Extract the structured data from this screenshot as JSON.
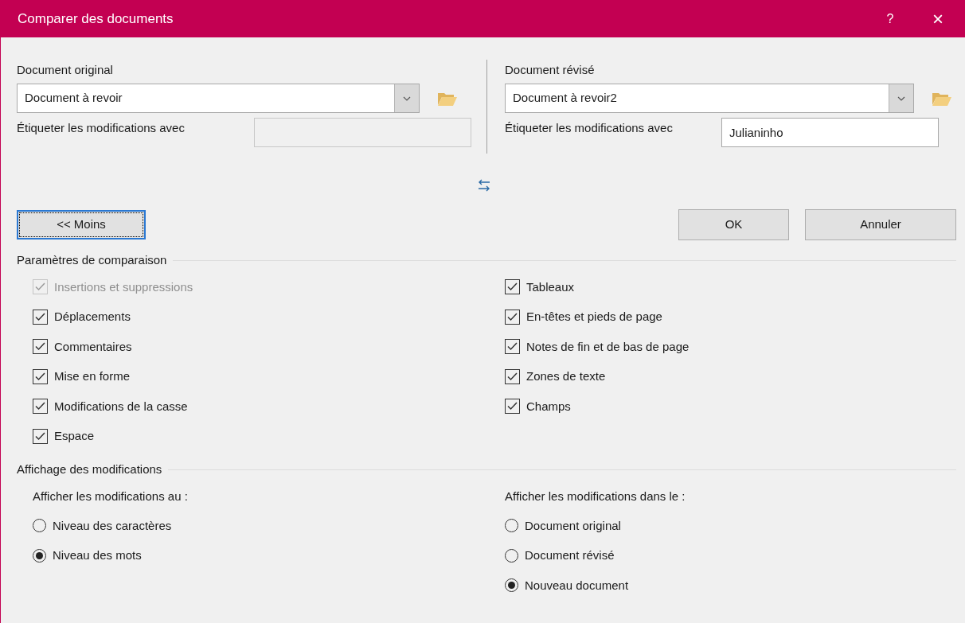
{
  "window": {
    "title": "Comparer des documents",
    "help": "?",
    "close": "×"
  },
  "original": {
    "label": "Document original",
    "combo_value": "Document à revoir",
    "tag_label": "Étiqueter les modifications avec",
    "tag_disabled": true
  },
  "revised": {
    "label": "Document révisé",
    "combo_value": "Document à revoir2",
    "tag_label": "Étiqueter les modifications avec",
    "tag_value": "Julianinho",
    "tag_disabled": false
  },
  "buttons": {
    "less": "<< Moins",
    "ok": "OK",
    "cancel": "Annuler"
  },
  "comparison_settings": {
    "title": "Paramètres de comparaison",
    "left": [
      {
        "label": "Insertions et suppressions",
        "checked": true,
        "disabled": true
      },
      {
        "label": "Déplacements",
        "checked": true,
        "disabled": false
      },
      {
        "label": "Commentaires",
        "checked": true,
        "disabled": false
      },
      {
        "label": "Mise en forme",
        "checked": true,
        "disabled": false
      },
      {
        "label": "Modifications de la casse",
        "checked": true,
        "disabled": false
      },
      {
        "label": "Espace",
        "checked": true,
        "disabled": false
      }
    ],
    "right": [
      {
        "label": "Tableaux",
        "checked": true,
        "disabled": false
      },
      {
        "label": "En-têtes et pieds de page",
        "checked": true,
        "disabled": false
      },
      {
        "label": "Notes de fin et de bas de page",
        "checked": true,
        "disabled": false
      },
      {
        "label": "Zones de texte",
        "checked": true,
        "disabled": false
      },
      {
        "label": "Champs",
        "checked": true,
        "disabled": false
      }
    ]
  },
  "show_changes": {
    "title": "Affichage des modifications",
    "level": {
      "label": "Afficher les modifications au :",
      "options": [
        {
          "label": "Niveau des caractères",
          "selected": false
        },
        {
          "label": "Niveau des mots",
          "selected": true
        }
      ]
    },
    "target": {
      "label": "Afficher les modifications dans le :",
      "options": [
        {
          "label": "Document original",
          "selected": false
        },
        {
          "label": "Document révisé",
          "selected": false
        },
        {
          "label": "Nouveau document",
          "selected": true
        }
      ]
    }
  }
}
